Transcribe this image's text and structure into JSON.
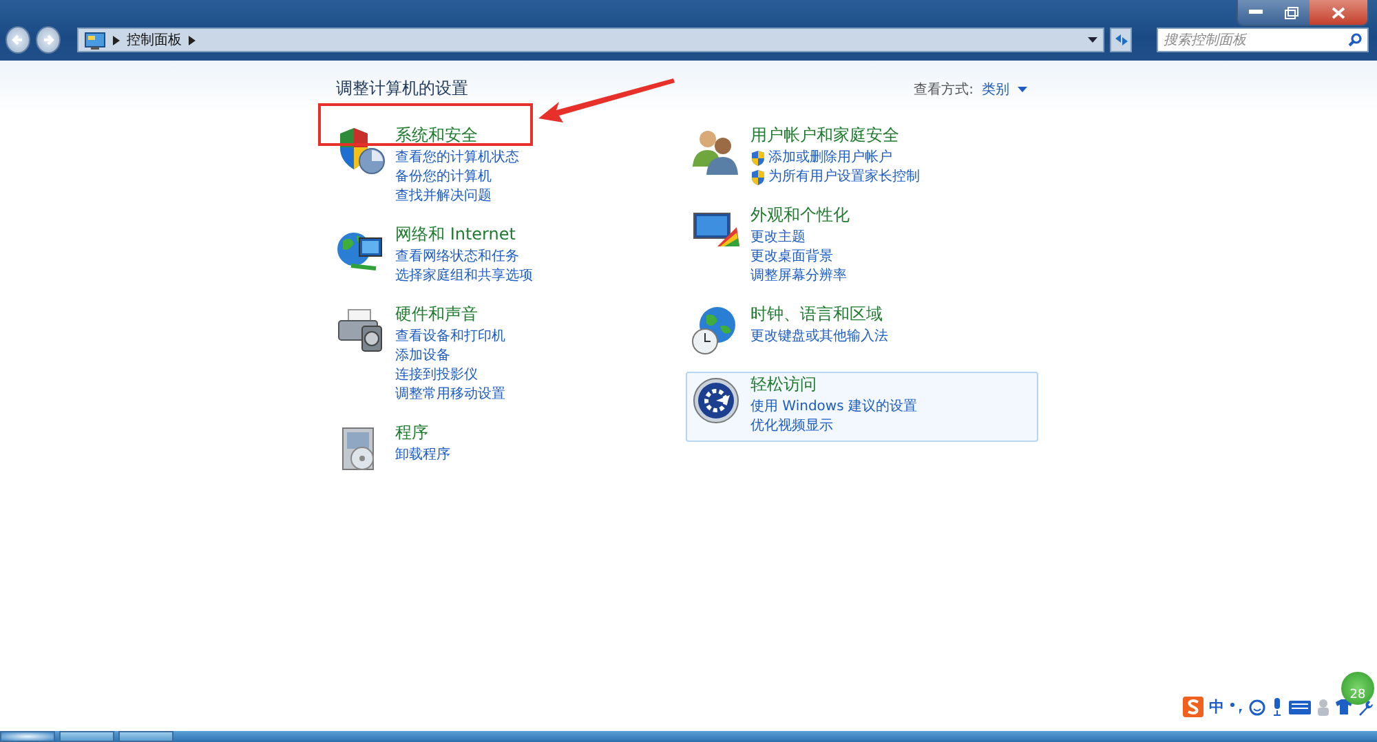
{
  "window": {
    "address": {
      "path": [
        "控制面板"
      ]
    },
    "search": {
      "placeholder": "搜索控制面板"
    }
  },
  "content": {
    "heading": "调整计算机的设置",
    "view_by": {
      "label": "查看方式:",
      "value": "类别"
    },
    "columns": [
      [
        {
          "title": "系统和安全",
          "highlighted": false,
          "links": [
            {
              "text": "查看您的计算机状态"
            },
            {
              "text": "备份您的计算机"
            },
            {
              "text": "查找并解决问题"
            }
          ]
        },
        {
          "title": "网络和 Internet",
          "highlighted": false,
          "links": [
            {
              "text": "查看网络状态和任务"
            },
            {
              "text": "选择家庭组和共享选项"
            }
          ]
        },
        {
          "title": "硬件和声音",
          "highlighted": false,
          "links": [
            {
              "text": "查看设备和打印机"
            },
            {
              "text": "添加设备"
            },
            {
              "text": "连接到投影仪"
            },
            {
              "text": "调整常用移动设置"
            }
          ]
        },
        {
          "title": "程序",
          "highlighted": false,
          "links": [
            {
              "text": "卸载程序"
            }
          ]
        }
      ],
      [
        {
          "title": "用户帐户和家庭安全",
          "highlighted": false,
          "links": [
            {
              "text": "添加或删除用户帐户",
              "shield": true
            },
            {
              "text": "为所有用户设置家长控制",
              "shield": true
            }
          ]
        },
        {
          "title": "外观和个性化",
          "highlighted": false,
          "links": [
            {
              "text": "更改主题"
            },
            {
              "text": "更改桌面背景"
            },
            {
              "text": "调整屏幕分辨率"
            }
          ]
        },
        {
          "title": "时钟、语言和区域",
          "highlighted": false,
          "links": [
            {
              "text": "更改键盘或其他输入法"
            }
          ]
        },
        {
          "title": "轻松访问",
          "highlighted": true,
          "links": [
            {
              "text": "使用 Windows 建议的设置"
            },
            {
              "text": "优化视频显示"
            }
          ]
        }
      ]
    ]
  },
  "ime_toolbar": {
    "mode": "中"
  },
  "badge": {
    "count": "28"
  }
}
